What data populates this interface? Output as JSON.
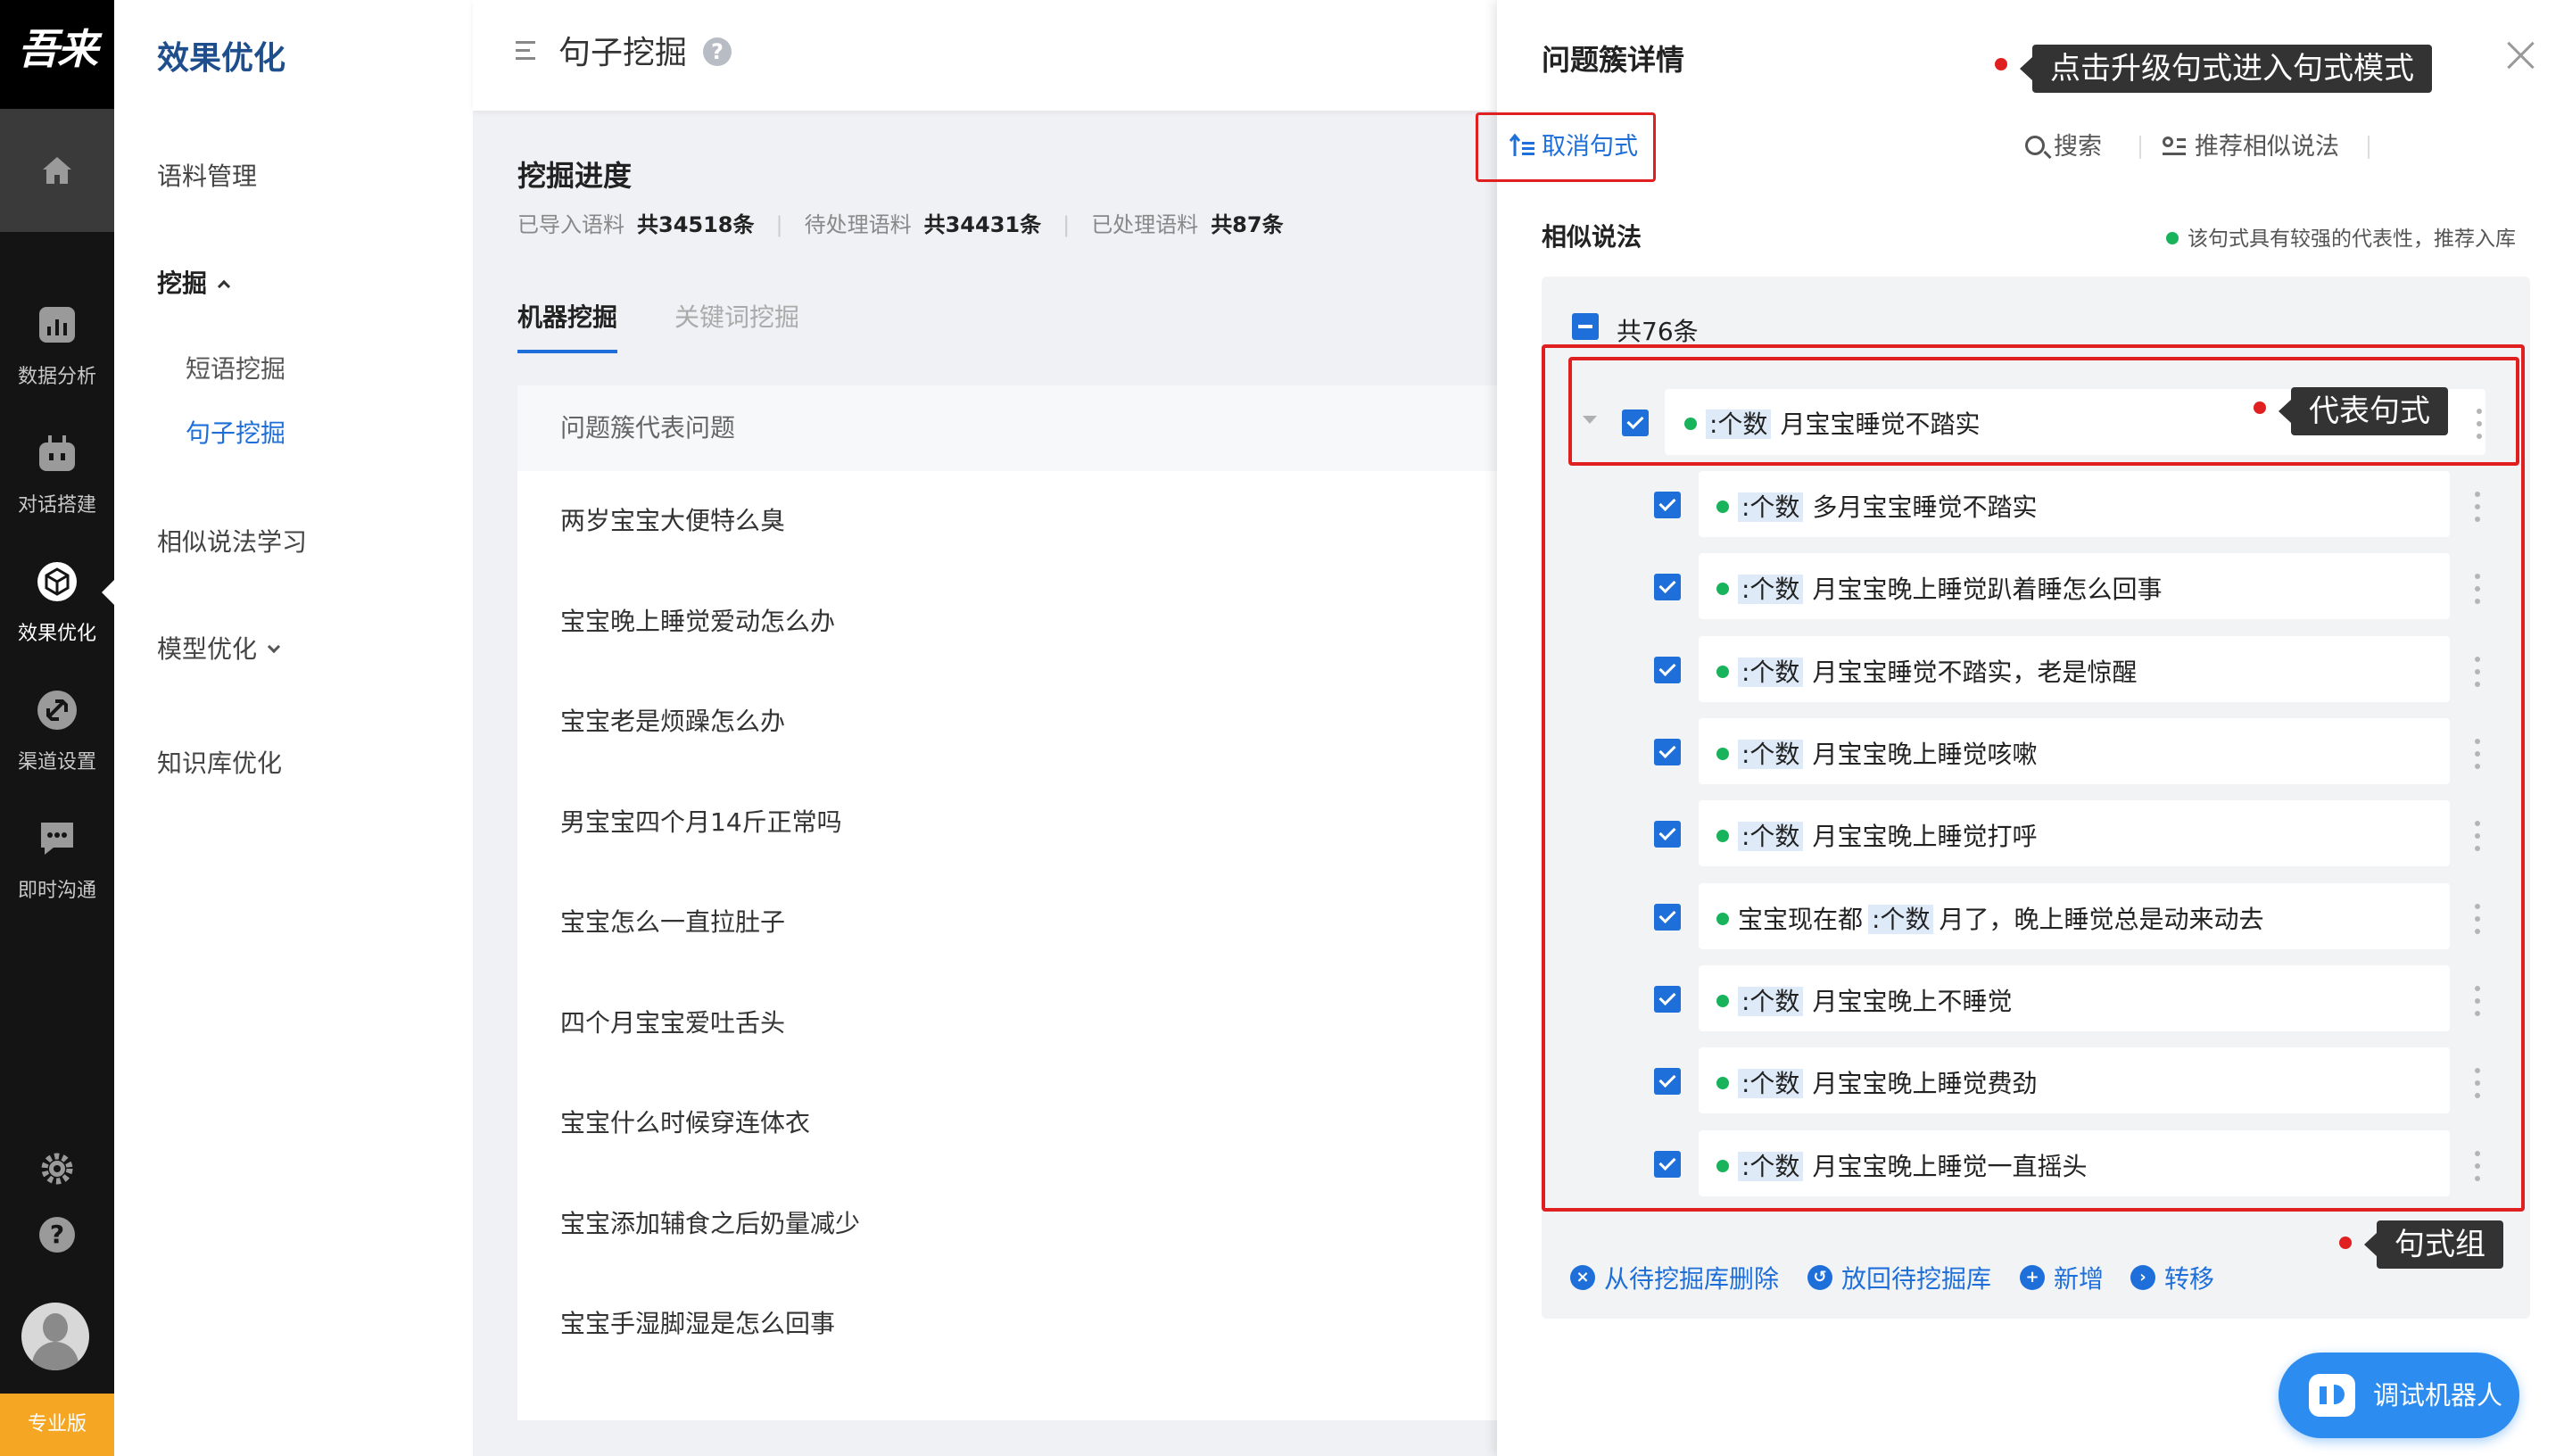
{
  "rail": {
    "logo": "吾来",
    "items": [
      {
        "label": "数据分析",
        "icon": "bar-chart-icon"
      },
      {
        "label": "对话搭建",
        "icon": "robot-icon"
      },
      {
        "label": "效果优化",
        "icon": "cube-icon"
      },
      {
        "label": "渠道设置",
        "icon": "link-icon"
      },
      {
        "label": "即时沟通",
        "icon": "chat-icon"
      }
    ],
    "edition": "专业版"
  },
  "subnav": {
    "title": "效果优化",
    "corpus": "语料管理",
    "mining": "挖掘",
    "phrase_mining": "短语挖掘",
    "sentence_mining": "句子挖掘",
    "similar_learning": "相似说法学习",
    "model_opt": "模型优化",
    "kb_opt": "知识库优化"
  },
  "main": {
    "title": "句子挖掘",
    "progress_title": "挖掘进度",
    "stats": [
      {
        "label": "已导入语料",
        "value": "共34518条"
      },
      {
        "label": "待处理语料",
        "value": "共34431条"
      },
      {
        "label": "已处理语料",
        "value": "共87条"
      }
    ],
    "tab_machine": "机器挖掘",
    "tab_keyword": "关键词挖掘",
    "table_header": "问题簇代表问题",
    "rows": [
      "两岁宝宝大便特么臭",
      "宝宝晚上睡觉爱动怎么办",
      "宝宝老是烦躁怎么办",
      "男宝宝四个月14斤正常吗",
      "宝宝怎么一直拉肚子",
      "四个月宝宝爱吐舌头",
      "宝宝什么时候穿连体衣",
      "宝宝添加辅食之后奶量减少",
      "宝宝手湿脚湿是怎么回事"
    ]
  },
  "drawer": {
    "title": "问题簇详情",
    "tooltip_upgrade": "点击升级句式进入句式模式",
    "search": "搜索",
    "recommend": "推荐相似说法",
    "cancel_pattern": "取消句式",
    "similar_label": "相似说法",
    "hint": "该句式具有较强的代表性，推荐入库",
    "count": "共76条",
    "tooltip_rep": "代表句式",
    "tooltip_group": "句式组",
    "slot": ":个数",
    "rep_item": "月宝宝睡觉不踏实",
    "items": [
      {
        "pre": "",
        "post": "多月宝宝睡觉不踏实"
      },
      {
        "pre": "",
        "post": "月宝宝晚上睡觉趴着睡怎么回事"
      },
      {
        "pre": "",
        "post": "月宝宝睡觉不踏实，老是惊醒"
      },
      {
        "pre": "",
        "post": "月宝宝晚上睡觉咳嗽"
      },
      {
        "pre": "",
        "post": "月宝宝晚上睡觉打呼"
      },
      {
        "pre": "宝宝现在都",
        "post": "月了，晚上睡觉总是动来动去"
      },
      {
        "pre": "",
        "post": "月宝宝晚上不睡觉"
      },
      {
        "pre": "",
        "post": "月宝宝晚上睡觉费劲"
      },
      {
        "pre": "",
        "post": "月宝宝晚上睡觉一直摇头"
      }
    ],
    "footer": {
      "delete": "从待挖掘库删除",
      "return": "放回待挖掘库",
      "add": "新增",
      "transfer": "转移"
    },
    "robot": "调试机器人"
  },
  "colors": {
    "accent": "#1e6fd9",
    "highlight_red": "#e02020",
    "status_green": "#19b35c",
    "rail_bg": "#141414",
    "edition_orange": "#f5a623"
  }
}
